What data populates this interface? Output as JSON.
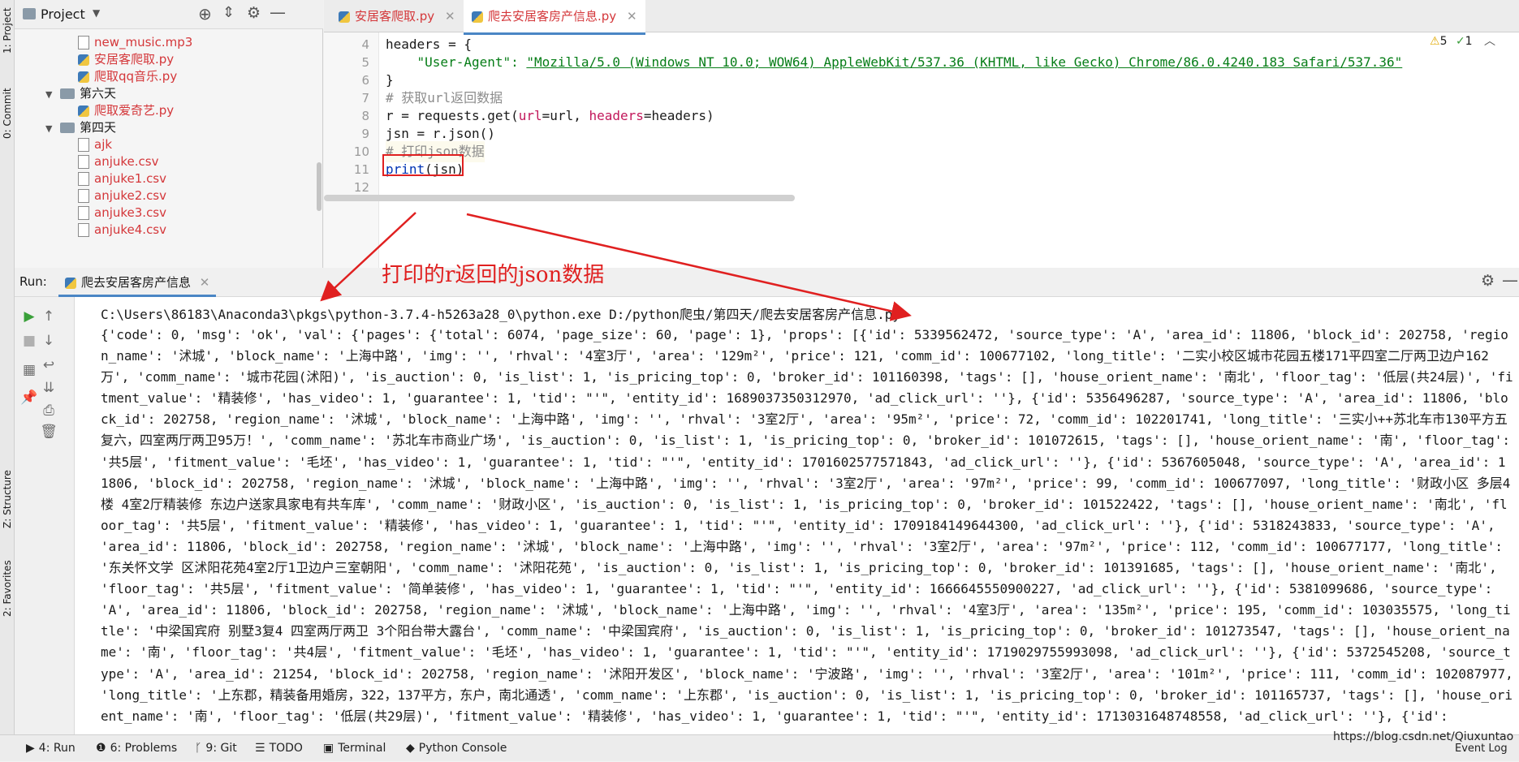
{
  "left_stripe": {
    "project_tab": "1: Project",
    "commit_tab": "0: Commit",
    "structure_tab": "Z: Structure",
    "favorites_tab": "2: Favorites"
  },
  "project_panel": {
    "title": "Project",
    "tree": [
      {
        "label": "new_music.mp3",
        "type": "file"
      },
      {
        "label": "安居客爬取.py",
        "type": "py"
      },
      {
        "label": "爬取qq音乐.py",
        "type": "py"
      },
      {
        "label": "第六天",
        "type": "folder"
      },
      {
        "label": "爬取爱奇艺.py",
        "type": "py"
      },
      {
        "label": "第四天",
        "type": "folder"
      },
      {
        "label": "ajk",
        "type": "file"
      },
      {
        "label": "anjuke.csv",
        "type": "file"
      },
      {
        "label": "anjuke1.csv",
        "type": "file"
      },
      {
        "label": "anjuke2.csv",
        "type": "file"
      },
      {
        "label": "anjuke3.csv",
        "type": "file"
      },
      {
        "label": "anjuke4.csv",
        "type": "file"
      }
    ]
  },
  "editor": {
    "tabs": [
      {
        "label": "安居客爬取.py"
      },
      {
        "label": "爬去安居客房产信息.py"
      }
    ],
    "inspections": {
      "warnings": "5",
      "checks": "1"
    },
    "lines": [
      {
        "num": "4",
        "parts": [
          {
            "t": "headers = {",
            "c": ""
          }
        ]
      },
      {
        "num": "5",
        "parts": [
          {
            "t": "    \"User-Agent\": ",
            "c": "kw-str"
          },
          {
            "t": "\"Mozilla/5.0 (Windows NT 10.0; WOW64) AppleWebKit/537.36 (KHTML, like Gecko) Chrome/86.0.4240.183 Safari/537.36\"",
            "c": "kw-str"
          }
        ]
      },
      {
        "num": "6",
        "parts": [
          {
            "t": "}",
            "c": ""
          }
        ]
      },
      {
        "num": "7",
        "parts": [
          {
            "t": "# 获取url返回数据",
            "c": "kw-cmt"
          }
        ]
      },
      {
        "num": "8",
        "parts": [
          {
            "t": "r = requests.get(",
            "c": ""
          },
          {
            "t": "url",
            "c": "kw-param"
          },
          {
            "t": "=url, ",
            "c": ""
          },
          {
            "t": "headers",
            "c": "kw-param"
          },
          {
            "t": "=headers)",
            "c": ""
          }
        ]
      },
      {
        "num": "9",
        "parts": [
          {
            "t": "jsn = r.json()",
            "c": ""
          }
        ]
      },
      {
        "num": "10",
        "parts": [
          {
            "t": "# 打印json数据",
            "c": "kw-cmt"
          }
        ]
      },
      {
        "num": "11",
        "parts": [
          {
            "t": "print",
            "c": "kw-print"
          },
          {
            "t": "(jsn)",
            "c": ""
          }
        ]
      },
      {
        "num": "12",
        "parts": [
          {
            "t": "",
            "c": ""
          }
        ]
      }
    ]
  },
  "annotation": {
    "text": "打印的r返回的json数据",
    "color": "#e02020"
  },
  "run_panel": {
    "label": "Run:",
    "tab": "爬去安居客房产信息",
    "command": "C:\\Users\\86183\\Anaconda3\\pkgs\\python-3.7.4-h5263a28_0\\python.exe D:/python爬虫/第四天/爬去安居客房产信息.py",
    "output": "{'code': 0, 'msg': 'ok', 'val': {'pages': {'total': 6074, 'page_size': 60, 'page': 1}, 'props': [{'id': 5339562472, 'source_type': 'A', 'area_id': 11806, 'block_id': 202758, 'region_name': '沭城', 'block_name': '上海中路', 'img': '', 'rhval': '4室3厅', 'area': '129m²', 'price': 121, 'comm_id': 100677102, 'long_title': '二实小校区城市花园五楼171平四室二厅两卫边户162万', 'comm_name': '城市花园(沭阳)', 'is_auction': 0, 'is_list': 1, 'is_pricing_top': 0, 'broker_id': 101160398, 'tags': [], 'house_orient_name': '南北', 'floor_tag': '低层(共24层)', 'fitment_value': '精装修', 'has_video': 1, 'guarantee': 1, 'tid': \"'\", 'entity_id': 1689037350312970, 'ad_click_url': ''}, {'id': 5356496287, 'source_type': 'A', 'area_id': 11806, 'block_id': 202758, 'region_name': '沭城', 'block_name': '上海中路', 'img': '', 'rhval': '3室2厅', 'area': '95m²', 'price': 72, 'comm_id': 102201741, 'long_title': '三实小++苏北车市130平方五复六，四室两厅两卫95万！', 'comm_name': '苏北车市商业广场', 'is_auction': 0, 'is_list': 1, 'is_pricing_top': 0, 'broker_id': 101072615, 'tags': [], 'house_orient_name': '南', 'floor_tag': '共5层', 'fitment_value': '毛坯', 'has_video': 1, 'guarantee': 1, 'tid': \"'\", 'entity_id': 1701602577571843, 'ad_click_url': ''}, {'id': 5367605048, 'source_type': 'A', 'area_id': 11806, 'block_id': 202758, 'region_name': '沭城', 'block_name': '上海中路', 'img': '', 'rhval': '3室2厅', 'area': '97m²', 'price': 99, 'comm_id': 100677097, 'long_title': '财政小区 多层4楼 4室2厅精装修 东边户送家具家电有共车库', 'comm_name': '财政小区', 'is_auction': 0, 'is_list': 1, 'is_pricing_top': 0, 'broker_id': 101522422, 'tags': [], 'house_orient_name': '南北', 'floor_tag': '共5层', 'fitment_value': '精装修', 'has_video': 1, 'guarantee': 1, 'tid': \"'\", 'entity_id': 1709184149644300, 'ad_click_url': ''}, {'id': 5318243833, 'source_type': 'A', 'area_id': 11806, 'block_id': 202758, 'region_name': '沭城', 'block_name': '上海中路', 'img': '', 'rhval': '3室2厅', 'area': '97m²', 'price': 112, 'comm_id': 100677177, 'long_title': '东关怀文学 区沭阳花苑4室2厅1卫边户三室朝阳', 'comm_name': '沭阳花苑', 'is_auction': 0, 'is_list': 1, 'is_pricing_top': 0, 'broker_id': 101391685, 'tags': [], 'house_orient_name': '南北', 'floor_tag': '共5层', 'fitment_value': '简单装修', 'has_video': 1, 'guarantee': 1, 'tid': \"'\", 'entity_id': 1666645550900227, 'ad_click_url': ''}, {'id': 5381099686, 'source_type': 'A', 'area_id': 11806, 'block_id': 202758, 'region_name': '沭城', 'block_name': '上海中路', 'img': '', 'rhval': '4室3厅', 'area': '135m²', 'price': 195, 'comm_id': 103035575, 'long_title': '中梁国宾府 别墅3复4 四室两厅两卫 3个阳台带大露台', 'comm_name': '中梁国宾府', 'is_auction': 0, 'is_list': 1, 'is_pricing_top': 0, 'broker_id': 101273547, 'tags': [], 'house_orient_name': '南', 'floor_tag': '共4层', 'fitment_value': '毛坯', 'has_video': 1, 'guarantee': 1, 'tid': \"'\", 'entity_id': 1719029755993098, 'ad_click_url': ''}, {'id': 5372545208, 'source_type': 'A', 'area_id': 21254, 'block_id': 202758, 'region_name': '沭阳开发区', 'block_name': '宁波路', 'img': '', 'rhval': '3室2厅', 'area': '101m²', 'price': 111, 'comm_id': 102087977, 'long_title': '上东郡，精装备用婚房，322，137平方，东户，南北通透', 'comm_name': '上东郡', 'is_auction': 0, 'is_list': 1, 'is_pricing_top': 0, 'broker_id': 101165737, 'tags': [], 'house_orient_name': '南', 'floor_tag': '低层(共29层)', 'fitment_value': '精装修', 'has_video': 1, 'guarantee': 1, 'tid': \"'\", 'entity_id': 1713031648748558, 'ad_click_url': ''}, {'id':"
  },
  "bottom_bar": {
    "tabs": [
      "4: Run",
      "6: Problems",
      "9: Git",
      "TODO",
      "Terminal",
      "Python Console"
    ],
    "watermark": "https://blog.csdn.net/Qiuxuntao",
    "event_log": "Event Log"
  }
}
